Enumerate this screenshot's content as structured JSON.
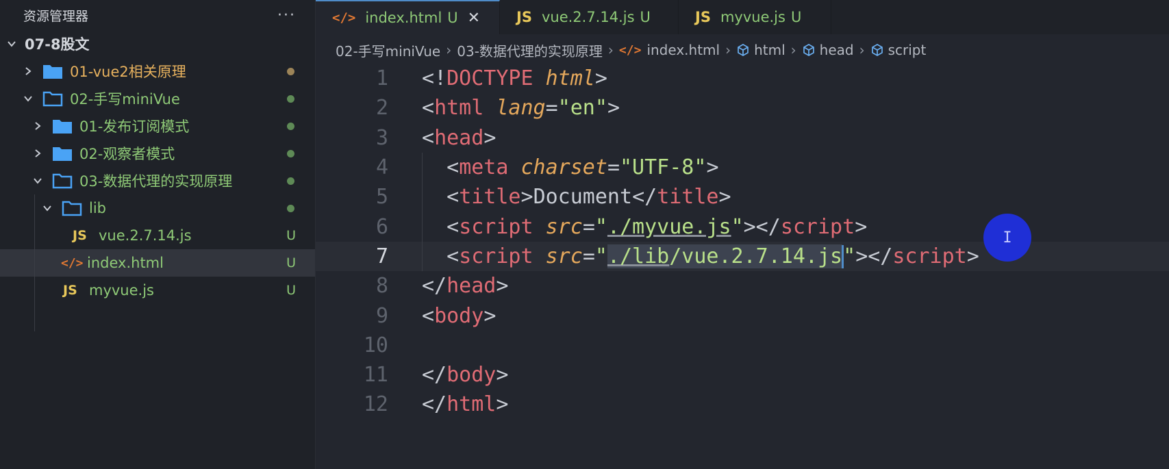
{
  "sidebar": {
    "title": "资源管理器",
    "more": "···",
    "root": "07-8股文",
    "items": [
      {
        "label": "01-vue2相关原理"
      },
      {
        "label": "02-手写miniVue"
      },
      {
        "label": "01-发布订阅模式"
      },
      {
        "label": "02-观察者模式"
      },
      {
        "label": "03-数据代理的实现原理"
      },
      {
        "label": "lib"
      },
      {
        "label": "vue.2.7.14.js",
        "badge": "U"
      },
      {
        "label": "index.html",
        "badge": "U"
      },
      {
        "label": "myvue.js",
        "badge": "U"
      }
    ],
    "js_icon": "JS",
    "html_icon": "</>"
  },
  "tabs": [
    {
      "icon": "</>",
      "label": "index.html",
      "badge": "U",
      "close": "✕"
    },
    {
      "icon": "JS",
      "label": "vue.2.7.14.js",
      "badge": "U"
    },
    {
      "icon": "JS",
      "label": "myvue.js",
      "badge": "U"
    }
  ],
  "breadcrumb": [
    "02-手写miniVue",
    "03-数据代理的实现原理",
    "index.html",
    "html",
    "head",
    "script"
  ],
  "breadcrumb_html_icon": "</>",
  "code": {
    "line_numbers": [
      "1",
      "2",
      "3",
      "4",
      "5",
      "6",
      "7",
      "8",
      "9",
      "10",
      "11",
      "12"
    ],
    "current_line": 7
  },
  "pointer": "I",
  "colors": {
    "accent": "#4f8cc9",
    "folder": "#4aa3f5",
    "git_untracked": "#8fca77",
    "pointer": "#1f2fd6"
  }
}
